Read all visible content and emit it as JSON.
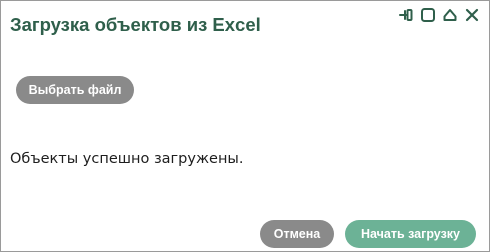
{
  "dialog": {
    "title": "Загрузка объектов из Excel",
    "window_controls": [
      {
        "icon": "pin-icon"
      },
      {
        "icon": "maximize-icon"
      },
      {
        "icon": "collapse-icon"
      },
      {
        "icon": "close-icon"
      }
    ],
    "choose_file_label": "Выбрать файл",
    "status_message": "Объекты успешно загружены.",
    "cancel_label": "Отмена",
    "start_label": "Начать загрузку"
  },
  "colors": {
    "title": "#2f5f4b",
    "icon": "#2f5f4b",
    "secondary_button": "#8a8a8a",
    "primary_button": "#6cb296",
    "border": "#9a9a9a",
    "text": "#1e1e1e"
  }
}
